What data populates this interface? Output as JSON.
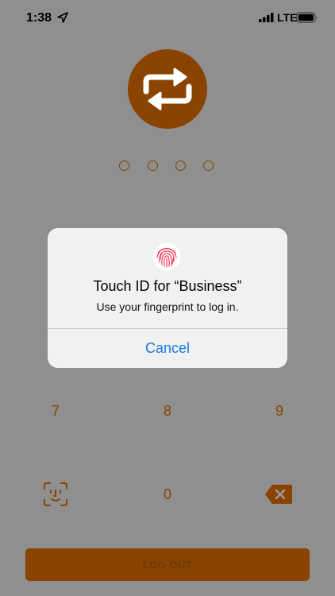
{
  "status_bar": {
    "time": "1:38",
    "carrier": "LTE",
    "location_icon": "location-arrow-icon",
    "signal_icon": "cellular-signal-icon",
    "battery_icon": "battery-icon"
  },
  "app": {
    "logo_icon": "refresh-arrows-icon",
    "passcode_length": 4,
    "keypad": {
      "row_visible": [
        "7",
        "8",
        "9"
      ],
      "zero": "0",
      "face_id_icon": "face-id-icon",
      "backspace_icon": "backspace-icon"
    },
    "logout_label": "LOG OUT",
    "accent_color": "#8a4300"
  },
  "dialog": {
    "icon": "fingerprint-icon",
    "title": "Touch ID for “Business”",
    "message": "Use your fingerprint to log in.",
    "cancel_label": "Cancel",
    "cancel_color": "#1a7ae0"
  }
}
